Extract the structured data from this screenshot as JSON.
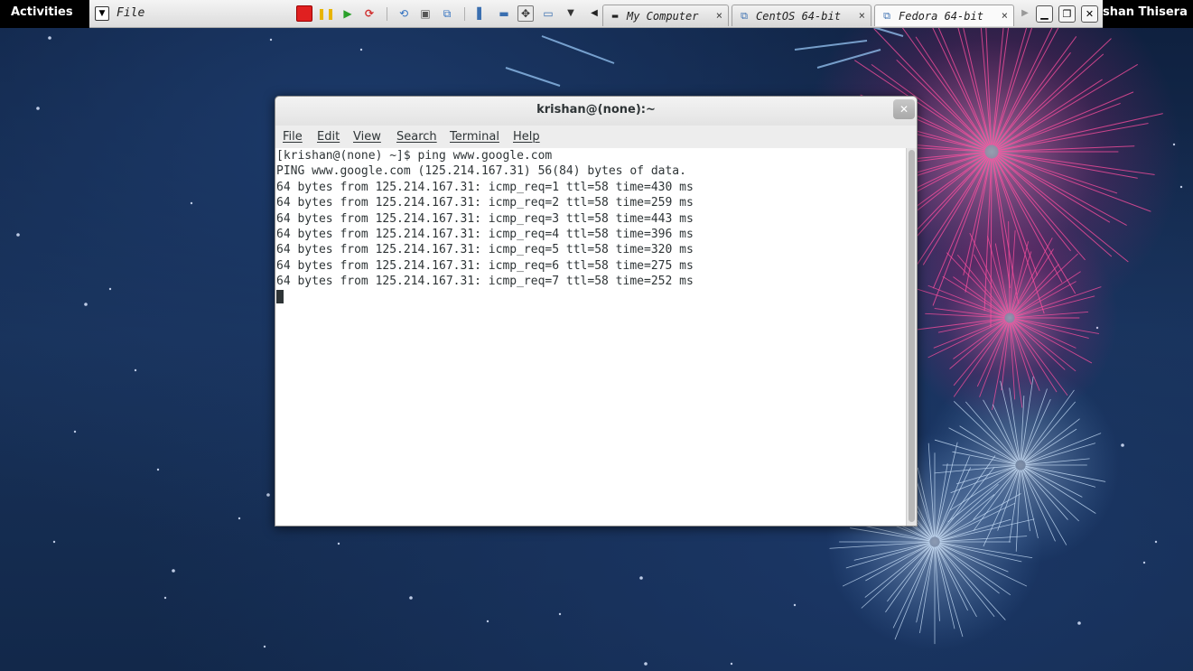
{
  "topbar": {
    "activities_label": "Activities",
    "username_label": "shan Thisera"
  },
  "vm_toolbar": {
    "file_menu_label": "File",
    "tabs": [
      {
        "label": "My Computer",
        "icon": "computer-icon",
        "close": "×"
      },
      {
        "label": "CentOS 64-bit",
        "icon": "vm-icon",
        "close": "×"
      },
      {
        "label": "Fedora 64-bit",
        "icon": "vm-icon",
        "close": "×",
        "active": true
      }
    ]
  },
  "terminal": {
    "title": "krishan@(none):~",
    "menu": [
      "File",
      "Edit",
      "View",
      "Search",
      "Terminal",
      "Help"
    ],
    "lines": [
      "[krishan@(none) ~]$ ping www.google.com",
      "PING www.google.com (125.214.167.31) 56(84) bytes of data.",
      "64 bytes from 125.214.167.31: icmp_req=1 ttl=58 time=430 ms",
      "64 bytes from 125.214.167.31: icmp_req=2 ttl=58 time=259 ms",
      "64 bytes from 125.214.167.31: icmp_req=3 ttl=58 time=443 ms",
      "64 bytes from 125.214.167.31: icmp_req=4 ttl=58 time=396 ms",
      "64 bytes from 125.214.167.31: icmp_req=5 ttl=58 time=320 ms",
      "64 bytes from 125.214.167.31: icmp_req=6 ttl=58 time=275 ms",
      "64 bytes from 125.214.167.31: icmp_req=7 ttl=58 time=252 ms"
    ]
  },
  "colors": {
    "topbar": "#000000",
    "terminal_text": "#2e3436",
    "firework_pink": "#ff4fa0",
    "firework_blue": "#cfe6ff"
  }
}
